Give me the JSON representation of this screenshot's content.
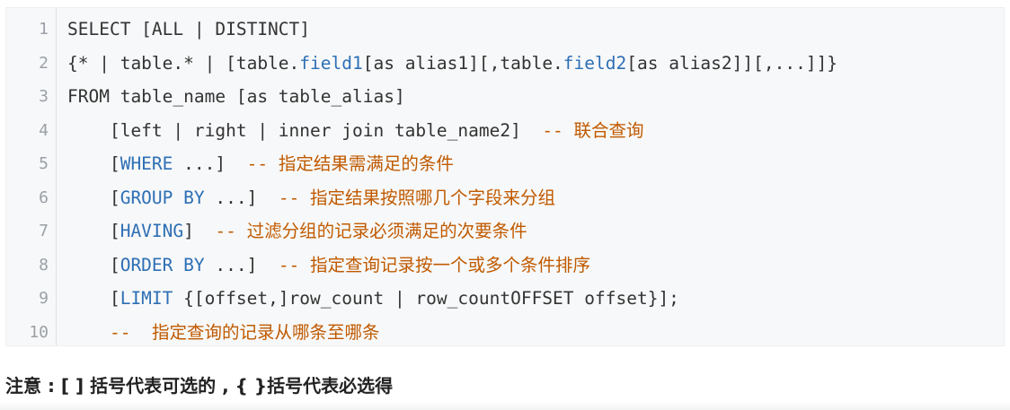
{
  "code": {
    "lines": [
      {
        "num": "1",
        "segments": [
          {
            "text": "SELECT [ALL | DISTINCT]",
            "style": "kw"
          }
        ]
      },
      {
        "num": "2",
        "segments": [
          {
            "text": "{* | table.* | [table.",
            "style": "kw"
          },
          {
            "text": "field1",
            "style": "blue"
          },
          {
            "text": "[as alias1][,table.",
            "style": "kw"
          },
          {
            "text": "field2",
            "style": "blue"
          },
          {
            "text": "[as alias2]][,...]]}",
            "style": "kw"
          }
        ]
      },
      {
        "num": "3",
        "segments": [
          {
            "text": "FROM table_name [as table_alias]",
            "style": "kw"
          }
        ]
      },
      {
        "num": "4",
        "segments": [
          {
            "text": "    [left | right | inner join table_name2]  ",
            "style": "kw"
          },
          {
            "text": "-- ",
            "style": "cmt"
          },
          {
            "text": "联合查询",
            "style": "cmt zh"
          }
        ]
      },
      {
        "num": "5",
        "segments": [
          {
            "text": "    [",
            "style": "kw"
          },
          {
            "text": "WHERE",
            "style": "blue"
          },
          {
            "text": " ...]  ",
            "style": "kw"
          },
          {
            "text": "-- ",
            "style": "cmt"
          },
          {
            "text": "指定结果需满足的条件",
            "style": "cmt zh"
          }
        ]
      },
      {
        "num": "6",
        "segments": [
          {
            "text": "    [",
            "style": "kw"
          },
          {
            "text": "GROUP BY",
            "style": "blue"
          },
          {
            "text": " ...]  ",
            "style": "kw"
          },
          {
            "text": "-- ",
            "style": "cmt"
          },
          {
            "text": "指定结果按照哪几个字段来分组",
            "style": "cmt zh"
          }
        ]
      },
      {
        "num": "7",
        "segments": [
          {
            "text": "    [",
            "style": "kw"
          },
          {
            "text": "HAVING",
            "style": "blue"
          },
          {
            "text": "]  ",
            "style": "kw"
          },
          {
            "text": "-- ",
            "style": "cmt"
          },
          {
            "text": "过滤分组的记录必须满足的次要条件",
            "style": "cmt zh"
          }
        ]
      },
      {
        "num": "8",
        "segments": [
          {
            "text": "    [",
            "style": "kw"
          },
          {
            "text": "ORDER BY",
            "style": "blue"
          },
          {
            "text": " ...]  ",
            "style": "kw"
          },
          {
            "text": "-- ",
            "style": "cmt"
          },
          {
            "text": "指定查询记录按一个或多个条件排序",
            "style": "cmt zh"
          }
        ]
      },
      {
        "num": "9",
        "segments": [
          {
            "text": "    [",
            "style": "kw"
          },
          {
            "text": "LIMIT",
            "style": "blue"
          },
          {
            "text": " {[offset,]row_count | row_countOFFSET offset}];",
            "style": "kw"
          }
        ]
      },
      {
        "num": "10",
        "segments": [
          {
            "text": "    ",
            "style": "kw"
          },
          {
            "text": "--  ",
            "style": "cmt"
          },
          {
            "text": "指定查询的记录从哪条至哪条",
            "style": "cmt zh"
          }
        ]
      }
    ]
  },
  "note": {
    "text": "注意 : [ ] 括号代表可选的 , { }括号代表必选得"
  }
}
